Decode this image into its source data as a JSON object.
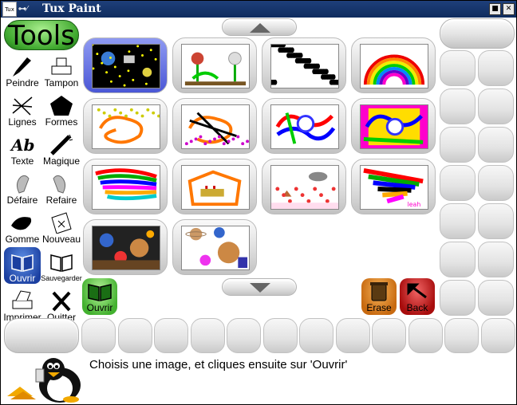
{
  "window": {
    "title": "Tux Paint",
    "icon_label": "Tux",
    "close_glyph": "■",
    "max_glyph": "✕"
  },
  "tools": {
    "header": "Tools",
    "items": [
      {
        "label": "Peindre",
        "icon": "paintbrush-icon"
      },
      {
        "label": "Tampon",
        "icon": "stamp-icon"
      },
      {
        "label": "Lignes",
        "icon": "lines-icon"
      },
      {
        "label": "Formes",
        "icon": "shapes-icon"
      },
      {
        "label": "Texte",
        "icon": "text-icon"
      },
      {
        "label": "Magique",
        "icon": "magic-wand-icon"
      },
      {
        "label": "Défaire",
        "icon": "undo-icon"
      },
      {
        "label": "Refaire",
        "icon": "redo-icon"
      },
      {
        "label": "Gomme",
        "icon": "eraser-icon"
      },
      {
        "label": "Nouveau",
        "icon": "new-page-icon"
      },
      {
        "label": "Ouvrir",
        "icon": "open-book-icon",
        "selected": true
      },
      {
        "label": "Sauvegarder",
        "icon": "save-icon"
      },
      {
        "label": "Imprimer",
        "icon": "printer-icon"
      },
      {
        "label": "Quitter",
        "icon": "quit-x-icon"
      }
    ],
    "text_icon_label": "Abc"
  },
  "actions": {
    "open": "Ouvrir",
    "erase": "Erase",
    "back": "Back"
  },
  "message": "Choisis une image, et cliques ensuite sur 'Ouvrir'",
  "thumbnails": [
    {
      "name": "space-scene",
      "selected": true
    },
    {
      "name": "flowers"
    },
    {
      "name": "penguin-pattern"
    },
    {
      "name": "rainbow-arc"
    },
    {
      "name": "stars-scribble"
    },
    {
      "name": "stars-scribble-2"
    },
    {
      "name": "rainbow-face"
    },
    {
      "name": "rainbow-face-pink"
    },
    {
      "name": "rainbow-tangle"
    },
    {
      "name": "orange-building"
    },
    {
      "name": "animals-hearts"
    },
    {
      "name": "colorful-mess",
      "caption": "leah"
    },
    {
      "name": "collage-1"
    },
    {
      "name": "collage-planets"
    }
  ],
  "colors": {
    "selected_blue": "#2c52c8",
    "tools_green": "#3fa82e",
    "erase_orange": "#e0841c",
    "back_red": "#cc1c1c"
  }
}
